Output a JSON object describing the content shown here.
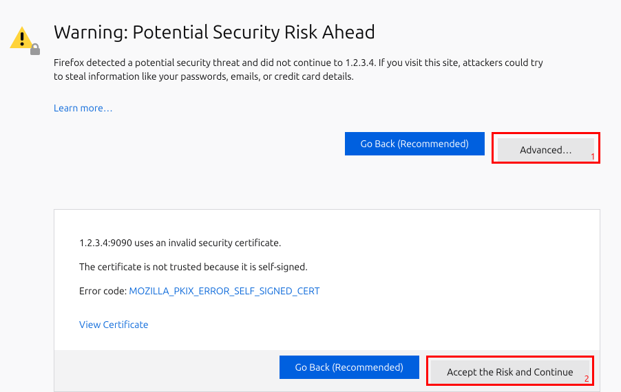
{
  "heading": "Warning: Potential Security Risk Ahead",
  "description_prefix": "Firefox detected a potential security threat and did not continue to ",
  "description_host": "1.2.3.4",
  "description_suffix": ". If you visit this site, attackers could try to steal information like your passwords, emails, or credit card details.",
  "learn_more": "Learn more…",
  "buttons": {
    "go_back": "Go Back (Recommended)",
    "advanced": "Advanced…",
    "accept": "Accept the Risk and Continue"
  },
  "details": {
    "host_port": "1.2.3.4:9090",
    "invalid_msg_suffix": " uses an invalid security certificate.",
    "reason": "The certificate is not trusted because it is self-signed.",
    "error_label": "Error code: ",
    "error_code": "MOZILLA_PKIX_ERROR_SELF_SIGNED_CERT",
    "view_cert": "View Certificate"
  },
  "annotations": {
    "box1": "1",
    "box2": "2"
  }
}
